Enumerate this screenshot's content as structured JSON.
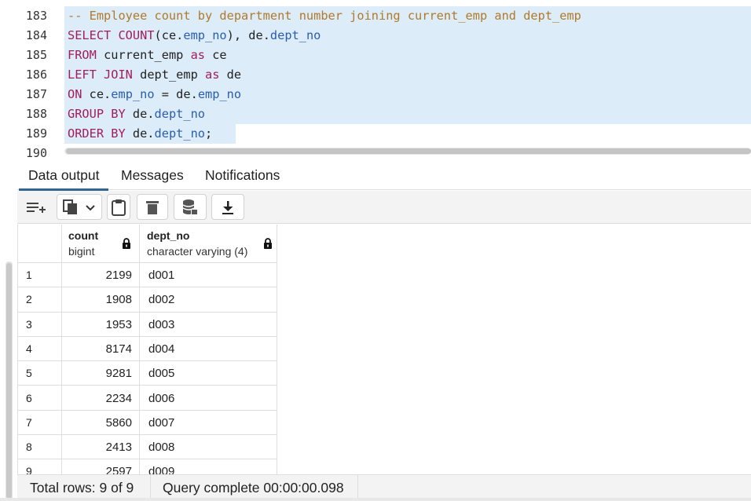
{
  "editor": {
    "partial_top_line": "182",
    "lines": [
      {
        "num": "183",
        "tokens": [
          {
            "t": "-- Employee count by department number joining current_emp and dept_emp",
            "c": "comment"
          }
        ]
      },
      {
        "num": "184",
        "tokens": [
          {
            "t": "SELECT ",
            "c": "kw"
          },
          {
            "t": "COUNT",
            "c": "kw"
          },
          {
            "t": "(ce.",
            "c": "plain"
          },
          {
            "t": "emp_no",
            "c": "id"
          },
          {
            "t": "), de.",
            "c": "plain"
          },
          {
            "t": "dept_no",
            "c": "id"
          }
        ]
      },
      {
        "num": "185",
        "tokens": [
          {
            "t": "FROM ",
            "c": "kw"
          },
          {
            "t": "current_emp ",
            "c": "plain"
          },
          {
            "t": "as ",
            "c": "kw"
          },
          {
            "t": "ce",
            "c": "plain"
          }
        ]
      },
      {
        "num": "186",
        "tokens": [
          {
            "t": "LEFT JOIN ",
            "c": "kw"
          },
          {
            "t": "dept_emp ",
            "c": "plain"
          },
          {
            "t": "as ",
            "c": "kw"
          },
          {
            "t": "de",
            "c": "plain"
          }
        ]
      },
      {
        "num": "187",
        "tokens": [
          {
            "t": "ON ",
            "c": "kw"
          },
          {
            "t": "ce.",
            "c": "plain"
          },
          {
            "t": "emp_no",
            "c": "id"
          },
          {
            "t": " = de.",
            "c": "plain"
          },
          {
            "t": "emp_no",
            "c": "id"
          }
        ]
      },
      {
        "num": "188",
        "tokens": [
          {
            "t": "GROUP BY ",
            "c": "kw"
          },
          {
            "t": "de.",
            "c": "plain"
          },
          {
            "t": "dept_no",
            "c": "id"
          }
        ]
      },
      {
        "num": "189",
        "tokens": [
          {
            "t": "ORDER BY ",
            "c": "kw"
          },
          {
            "t": "de.",
            "c": "plain"
          },
          {
            "t": "dept_no",
            "c": "id"
          },
          {
            "t": ";",
            "c": "plain"
          }
        ]
      },
      {
        "num": "190",
        "tokens": []
      }
    ]
  },
  "tabs": [
    {
      "label": "Data output",
      "active": true
    },
    {
      "label": "Messages",
      "active": false
    },
    {
      "label": "Notifications",
      "active": false
    }
  ],
  "toolbar": {
    "buttons": [
      "add-row-icon",
      "copy-icon",
      "chevron-down-icon",
      "paste-icon",
      "delete-icon",
      "save-data-icon",
      "download-icon"
    ]
  },
  "grid": {
    "columns": [
      {
        "name": "count",
        "type": "bigint"
      },
      {
        "name": "dept_no",
        "type": "character varying (4)"
      }
    ],
    "rows": [
      {
        "n": "1",
        "count": "2199",
        "dept": "d001"
      },
      {
        "n": "2",
        "count": "1908",
        "dept": "d002"
      },
      {
        "n": "3",
        "count": "1953",
        "dept": "d003"
      },
      {
        "n": "4",
        "count": "8174",
        "dept": "d004"
      },
      {
        "n": "5",
        "count": "9281",
        "dept": "d005"
      },
      {
        "n": "6",
        "count": "2234",
        "dept": "d006"
      },
      {
        "n": "7",
        "count": "5860",
        "dept": "d007"
      },
      {
        "n": "8",
        "count": "2413",
        "dept": "d008"
      },
      {
        "n": "9",
        "count": "2597",
        "dept": "d009"
      }
    ]
  },
  "status": {
    "total_rows": "Total rows: 9 of 9",
    "query": "Query complete 00:00:00.098"
  }
}
